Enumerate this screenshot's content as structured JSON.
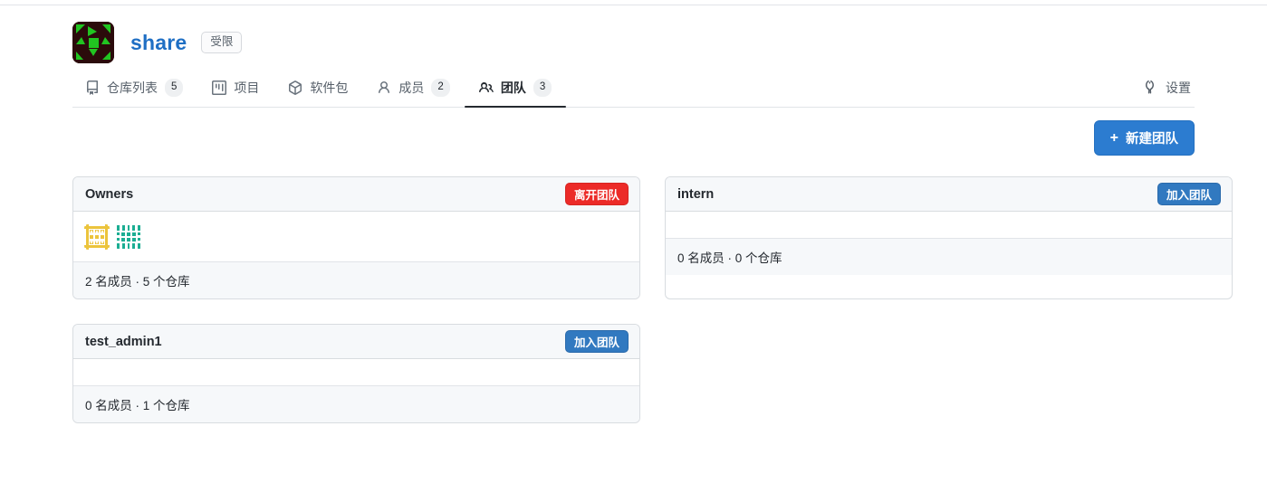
{
  "org": {
    "name": "share",
    "badge": "受限",
    "avatar_icon": "org-identicon-green"
  },
  "nav": {
    "tabs": [
      {
        "label": "仓库列表",
        "count": "5",
        "icon": "repo-icon",
        "active": false
      },
      {
        "label": "项目",
        "count": "",
        "icon": "project-icon",
        "active": false
      },
      {
        "label": "软件包",
        "count": "",
        "icon": "package-icon",
        "active": false
      },
      {
        "label": "成员",
        "count": "2",
        "icon": "person-icon",
        "active": false
      },
      {
        "label": "团队",
        "count": "3",
        "icon": "people-icon",
        "active": true
      }
    ],
    "settings": {
      "label": "设置",
      "icon": "tools-icon"
    }
  },
  "toolbar": {
    "new_team_label": "新建团队",
    "new_team_plus": "+"
  },
  "teams": [
    {
      "name": "Owners",
      "action_label": "离开团队",
      "action_type": "leave",
      "stats": "2 名成员 · 5 个仓库",
      "members": [
        {
          "avatar_icon": "member-identicon-yellow",
          "color": "#ecc43c"
        },
        {
          "avatar_icon": "member-identicon-teal",
          "color": "#1cae93"
        }
      ]
    },
    {
      "name": "intern",
      "action_label": "加入团队",
      "action_type": "join",
      "stats": "0 名成员 · 0 个仓库",
      "members": []
    },
    {
      "name": "test_admin1",
      "action_label": "加入团队",
      "action_type": "join",
      "stats": "0 名成员 · 1 个仓库",
      "members": []
    }
  ],
  "colors": {
    "primary_blue": "#3179c0",
    "danger_red": "#ec2b28",
    "link_blue": "#1f6fc4",
    "header_bg": "#f6f8fa",
    "border": "#d8dce0"
  }
}
